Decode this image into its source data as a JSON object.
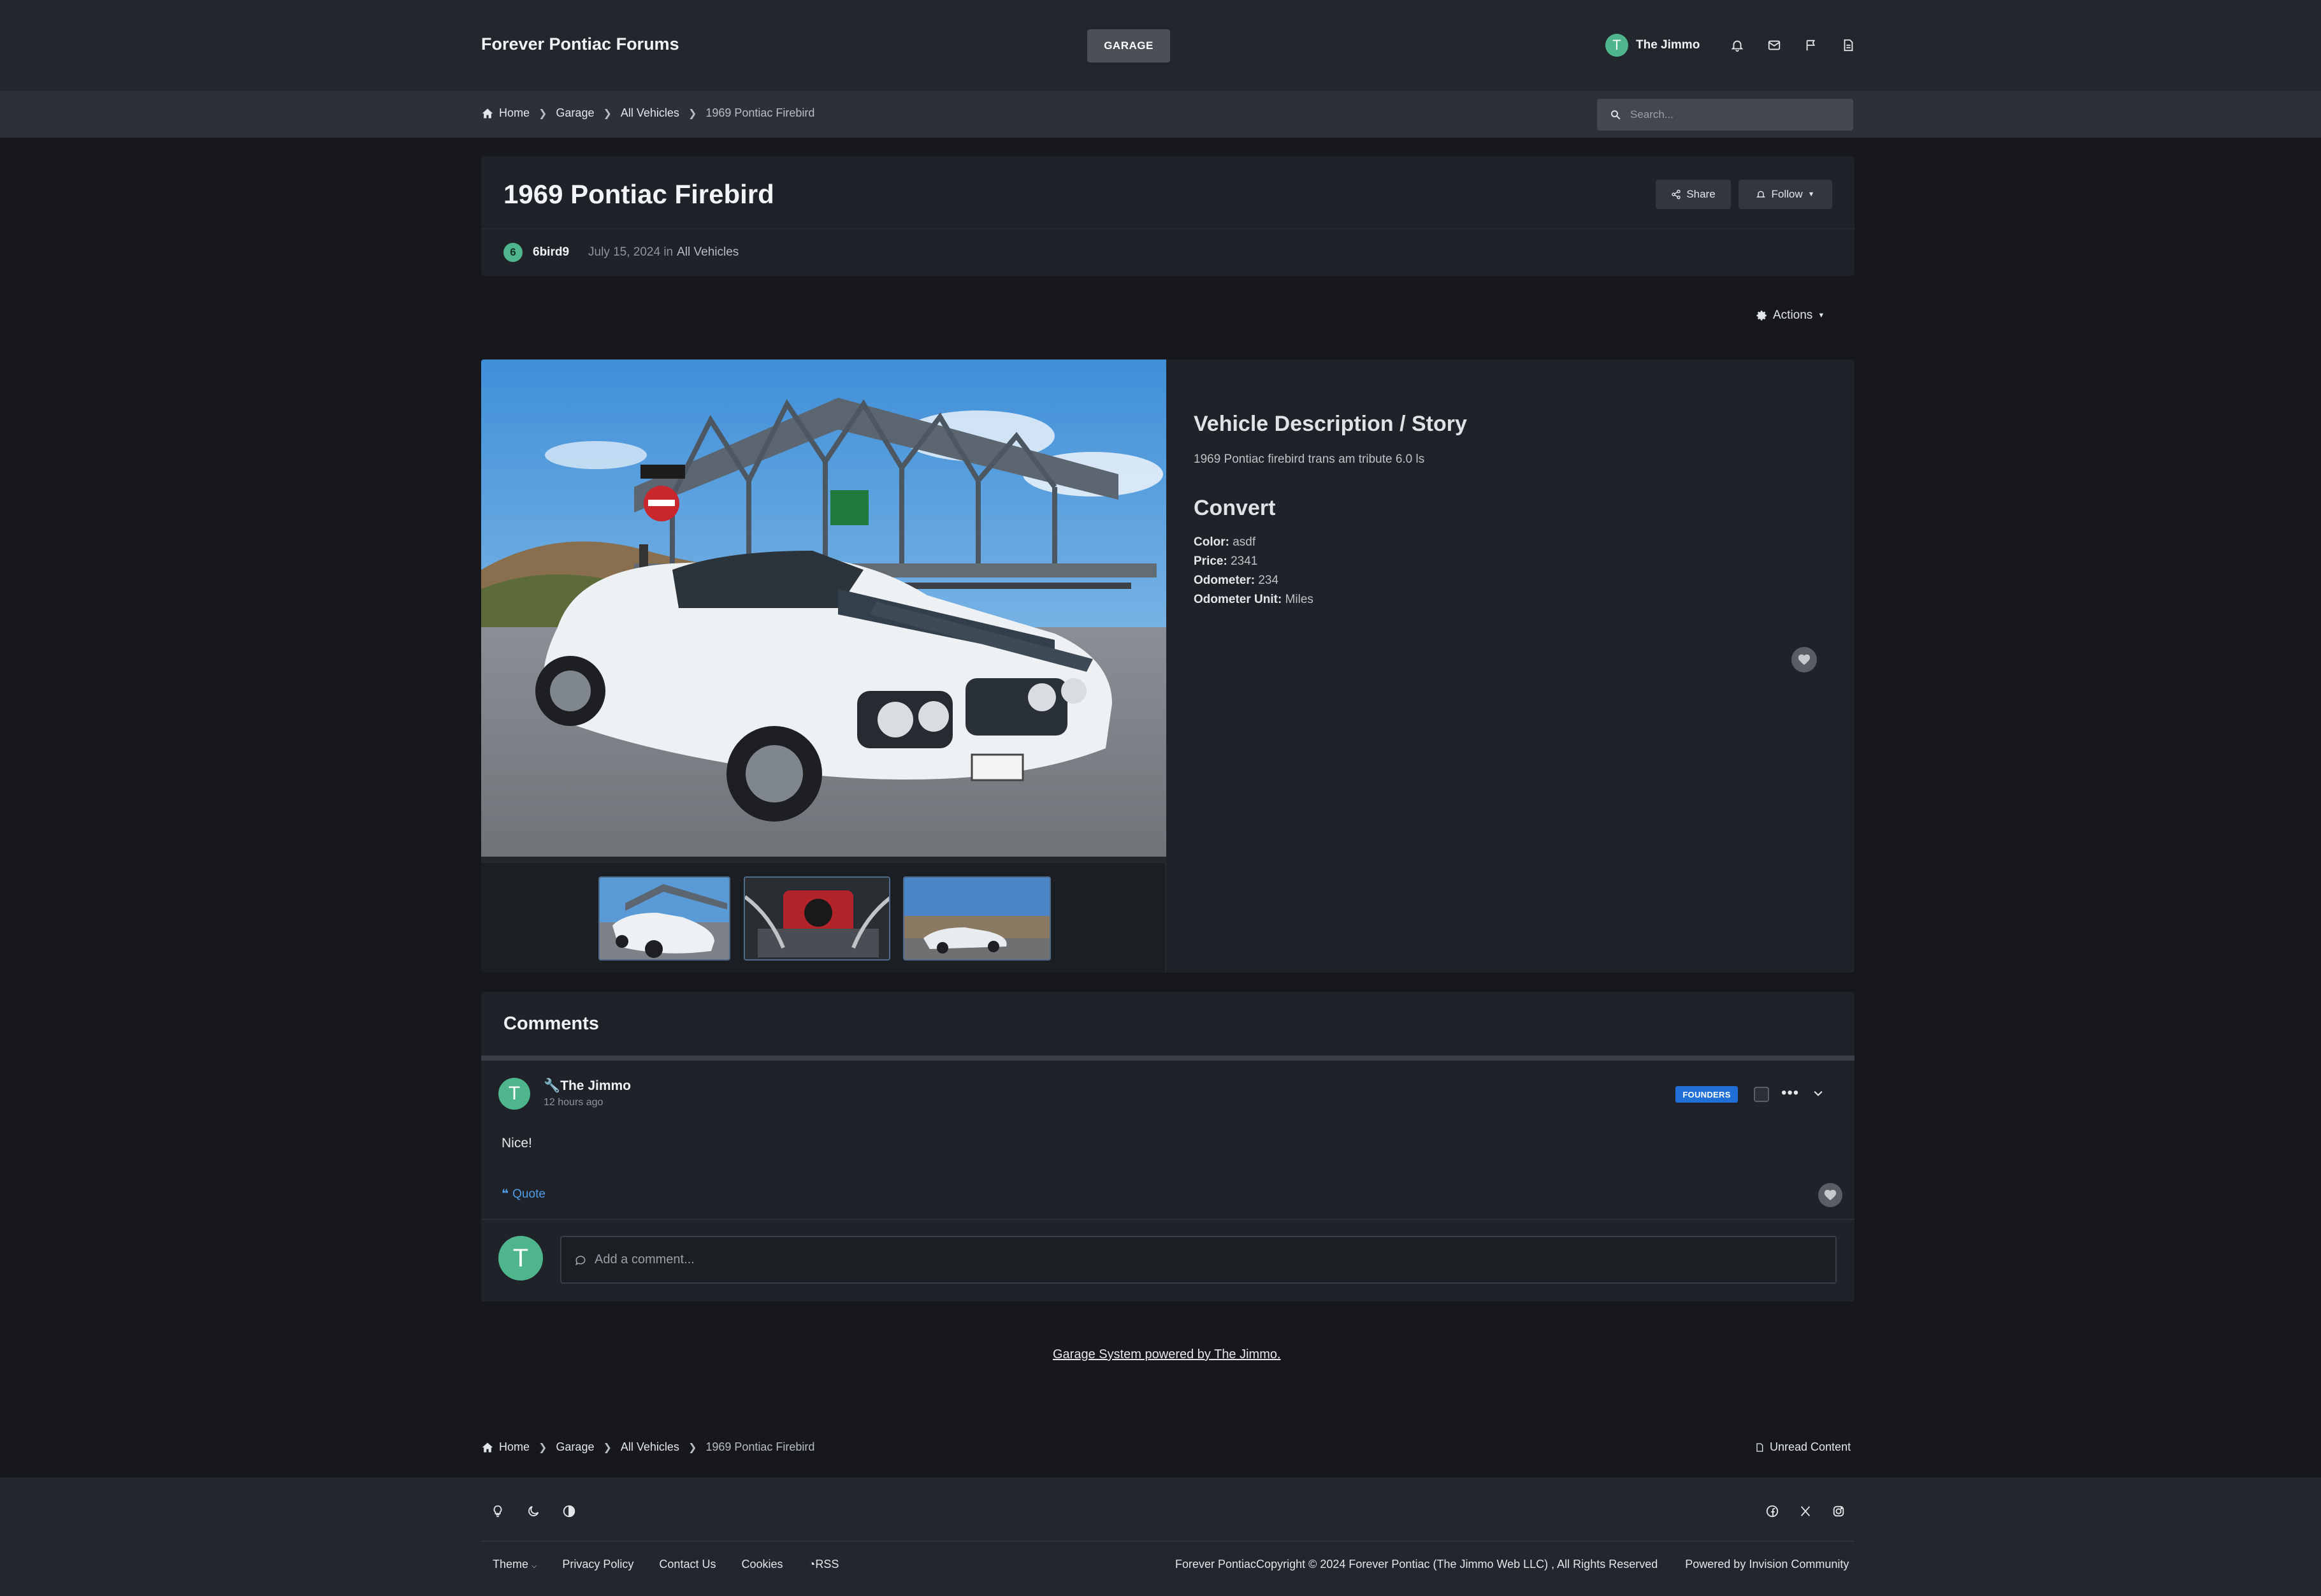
{
  "header": {
    "brand": "Forever Pontiac Forums",
    "garage_label": "GARAGE",
    "user_initial": "T",
    "user_name": "The Jimmo"
  },
  "breadcrumb": {
    "items": [
      "Home",
      "Garage",
      "All Vehicles",
      "1969 Pontiac Firebird"
    ]
  },
  "search": {
    "placeholder": "Search..."
  },
  "vehicle": {
    "title": "1969 Pontiac Firebird",
    "share_label": "Share",
    "follow_label": "Follow",
    "author_initial": "6",
    "author": "6bird9",
    "date": "July 15, 2024 in",
    "category": "All Vehicles",
    "actions_label": "Actions"
  },
  "description": {
    "heading": "Vehicle Description / Story",
    "story": "1969 Pontiac firebird trans am tribute 6.0 ls",
    "section2_heading": "Convert",
    "specs": [
      {
        "label": "Color:",
        "value": "asdf"
      },
      {
        "label": "Price:",
        "value": "2341"
      },
      {
        "label": "Odometer:",
        "value": "234"
      },
      {
        "label": "Odometer Unit:",
        "value": "Miles"
      }
    ]
  },
  "comments": {
    "title": "Comments",
    "items": [
      {
        "initial": "T",
        "author": "🔧The Jimmo",
        "time": "12 hours ago",
        "badge": "FOUNDERS",
        "body": "Nice!",
        "quote_label": "Quote"
      }
    ],
    "commenter_initial": "T",
    "add_placeholder": "Add a comment..."
  },
  "powered_by": "Garage System powered by The Jimmo.",
  "unread_label": "Unread Content",
  "footer": {
    "theme_label": "Theme",
    "privacy": "Privacy Policy",
    "contact": "Contact Us",
    "cookies": "Cookies",
    "rss": "RSS",
    "copyright": "Forever PontiacCopyright © 2024 Forever Pontiac (The Jimmo Web LLC) , All Rights Reserved",
    "powered": "Powered by Invision Community"
  },
  "colors": {
    "accent": "#1f6fd6",
    "avatar": "#4fb58c",
    "link": "#4f9de8"
  }
}
